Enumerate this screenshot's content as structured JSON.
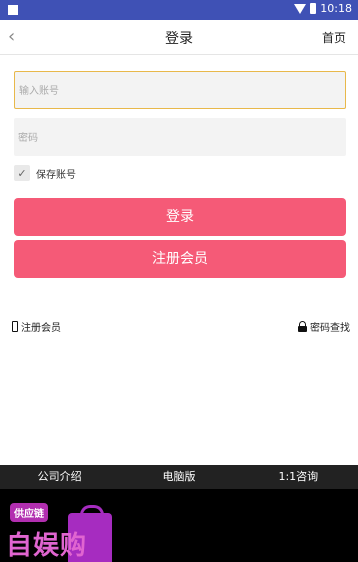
{
  "status": {
    "time": "10:18"
  },
  "nav": {
    "back_glyph": "‹",
    "title": "登录",
    "home_label": "首页"
  },
  "form": {
    "account_placeholder": "输入账号",
    "account_value": "",
    "password_placeholder": "密码",
    "password_value": "",
    "remember_label": "保存账号",
    "remember_checked": true,
    "check_glyph": "✓"
  },
  "buttons": {
    "login_label": "登录",
    "register_label": "注册会员"
  },
  "links": {
    "register_label": "注册会员",
    "password_recovery_label": "密码查找"
  },
  "footer": {
    "items": [
      "公司介绍",
      "电脑版",
      "1:1咨询"
    ]
  },
  "promo": {
    "badge_text": "供应链",
    "brand_text": "自娱购"
  },
  "colors": {
    "status_bar": "#3f51b5",
    "primary_button": "#f55a77",
    "input_focus_border": "#e8b84a",
    "footer_bg": "#222222"
  }
}
